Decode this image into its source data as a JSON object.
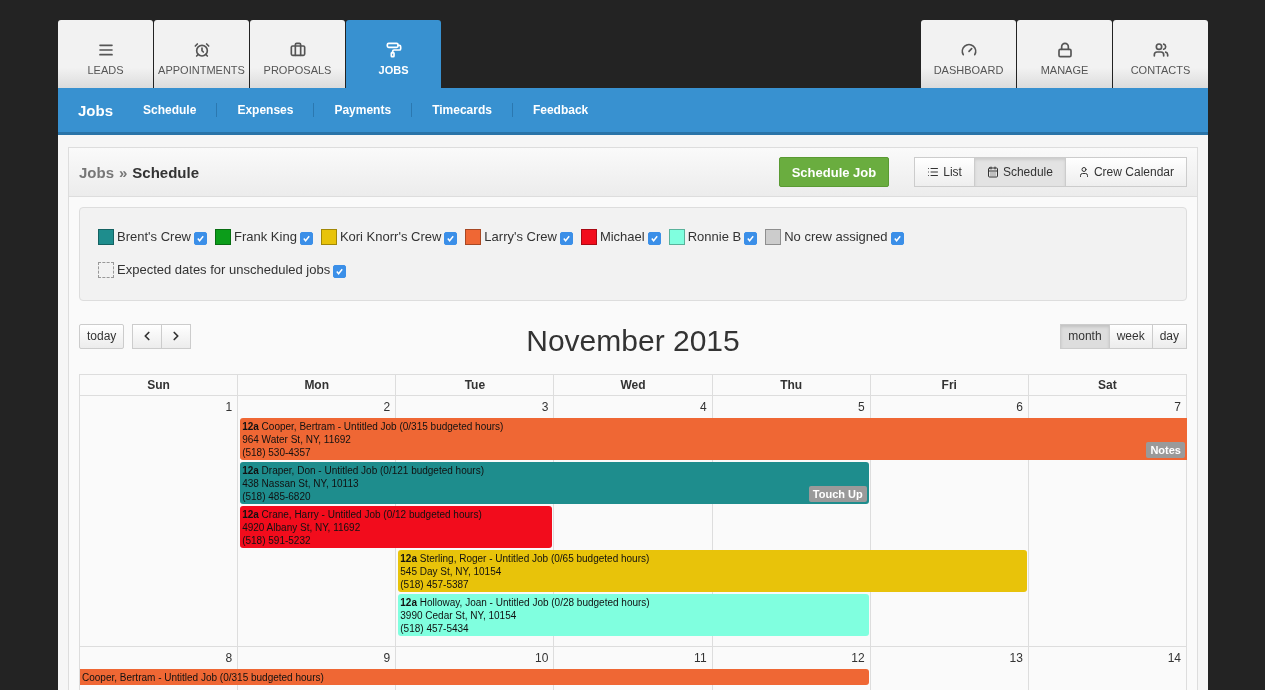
{
  "main_tabs": [
    {
      "label": "LEADS",
      "selected": false
    },
    {
      "label": "APPOINTMENTS",
      "selected": false
    },
    {
      "label": "PROPOSALS",
      "selected": false
    },
    {
      "label": "JOBS",
      "selected": true
    }
  ],
  "right_tabs": [
    {
      "label": "DASHBOARD",
      "selected": false
    },
    {
      "label": "MANAGE",
      "selected": false
    },
    {
      "label": "CONTACTS",
      "selected": false
    }
  ],
  "subnav": {
    "title": "Jobs",
    "links": [
      "Schedule",
      "Expenses",
      "Payments",
      "Timecards",
      "Feedback"
    ]
  },
  "breadcrumb": {
    "parent": "Jobs",
    "separator": "»",
    "current": "Schedule"
  },
  "schedule_button": "Schedule Job",
  "views": [
    {
      "label": "List",
      "selected": false
    },
    {
      "label": "Schedule",
      "selected": true
    },
    {
      "label": "Crew Calendar",
      "selected": false
    }
  ],
  "legend": [
    {
      "kind": "swatch",
      "label": "Brent's Crew",
      "color": "#1e8d8d",
      "checked": true
    },
    {
      "kind": "swatch",
      "label": "Frank King",
      "color": "#0c9d1a",
      "checked": true
    },
    {
      "kind": "swatch",
      "label": "Kori Knorr's Crew",
      "color": "#e8c30a",
      "checked": true
    },
    {
      "kind": "swatch",
      "label": "Larry's Crew",
      "color": "#ef6734",
      "checked": true
    },
    {
      "kind": "swatch",
      "label": "Michael",
      "color": "#f20c1c",
      "checked": true
    },
    {
      "kind": "swatch",
      "label": "Ronnie B",
      "color": "#80ffdf",
      "checked": true
    },
    {
      "kind": "swatch",
      "label": "No crew assigned",
      "color": "#cccccc",
      "checked": true
    },
    {
      "kind": "dashed",
      "label": "Expected dates for unscheduled jobs",
      "checked": true
    }
  ],
  "calendar": {
    "today": "today",
    "title": "November 2015",
    "ranges": [
      {
        "label": "month",
        "selected": true
      },
      {
        "label": "week",
        "selected": false
      },
      {
        "label": "day",
        "selected": false
      }
    ],
    "weekdays": [
      "Sun",
      "Mon",
      "Tue",
      "Wed",
      "Thu",
      "Fri",
      "Sat"
    ],
    "weeks": [
      {
        "days": [
          "1",
          "2",
          "3",
          "4",
          "5",
          "6",
          "7"
        ],
        "events": [
          {
            "color": "#ef6734",
            "lines": [
              "**12a** Cooper, Bertram - Untitled Job (0/315 budgeted hours)",
              "964 Water St, NY, 11692",
              "(518) 530-4357"
            ],
            "tag": "Notes"
          },
          {
            "color": "#1e8d8d",
            "lines": [
              "**12a** Draper, Don - Untitled Job (0/121 budgeted hours)",
              "438 Nassan St, NY, 10113",
              "(518) 485-6820"
            ],
            "tag": "Touch Up"
          },
          {
            "color": "#f20c1c",
            "lines": [
              "**12a** Crane, Harry - Untitled Job (0/12 budgeted hours)",
              "4920 Albany St, NY, 11692",
              "(518) 591-5232"
            ]
          },
          {
            "color": "#e8c30a",
            "lines": [
              "**12a** Sterling, Roger - Untitled Job (0/65 budgeted hours)",
              "545 Day St, NY, 10154",
              "(518) 457-5387"
            ]
          },
          {
            "color": "#80ffdf",
            "lines": [
              "**12a** Holloway, Joan - Untitled Job (0/28 budgeted hours)",
              "3990 Cedar St, NY, 10154",
              "(518) 457-5434"
            ]
          }
        ]
      },
      {
        "days": [
          "8",
          "9",
          "10",
          "11",
          "12",
          "13",
          "14"
        ],
        "events": [
          {
            "color": "#ef6734",
            "lines": [
              "Cooper, Bertram - Untitled Job (0/315 budgeted hours)"
            ]
          }
        ]
      }
    ]
  }
}
